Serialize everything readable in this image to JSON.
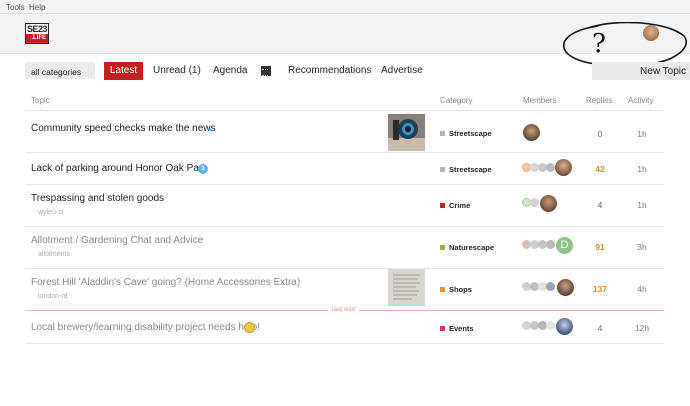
{
  "menubar": {
    "tools": "Tools",
    "help": "Help"
  },
  "logo": {
    "top": "SE23",
    "bottom": ".LIFE"
  },
  "scribble_text": "?",
  "nav": {
    "category_select": "all categories",
    "latest": "Latest",
    "unread": "Unread (1)",
    "agenda": "Agenda",
    "recommendations": "Recommendations",
    "advertise": "Advertise",
    "new_topic": "New Topic"
  },
  "table": {
    "headers": {
      "topic": "Topic",
      "category": "Category",
      "members": "Members",
      "replies": "Replies",
      "activity": "Activity"
    },
    "rows": [
      {
        "title": "Community speed checks make the news",
        "tag": "",
        "category": "Streetscape",
        "cat_color": "#b3b3b3",
        "replies": "0",
        "activity": "1h"
      },
      {
        "title": "Lack of parking around Honor Oak Park",
        "tag": "",
        "badge": "1",
        "category": "Streetscape",
        "cat_color": "#b3b3b3",
        "replies": "42",
        "activity": "1h"
      },
      {
        "title": "Trespassing and stolen goods",
        "tag": "wyleu-st",
        "category": "Crime",
        "cat_color": "#c0211f",
        "replies": "4",
        "activity": "1h"
      },
      {
        "title": "Allotment / Gardening Chat and Advice",
        "tag": "allotments",
        "category": "Naturescape",
        "cat_color": "#8bb93c",
        "replies": "91",
        "activity": "3h"
      },
      {
        "title": "Forest Hill 'Aladdin's Cave' going? (Home Accessories Extra)",
        "tag": "london-rd",
        "category": "Shops",
        "cat_color": "#f0922b",
        "replies": "137",
        "activity": "4h"
      },
      {
        "title": "Local brewery/learning disability project needs help!",
        "tag": "",
        "category": "Events",
        "cat_color": "#e0307a",
        "replies": "4",
        "activity": "12h"
      }
    ],
    "last_visit_label": "last visit",
    "member_letter": "D"
  },
  "colors": {
    "brand": "#c0211f",
    "hot_replies": "#e08a27"
  }
}
